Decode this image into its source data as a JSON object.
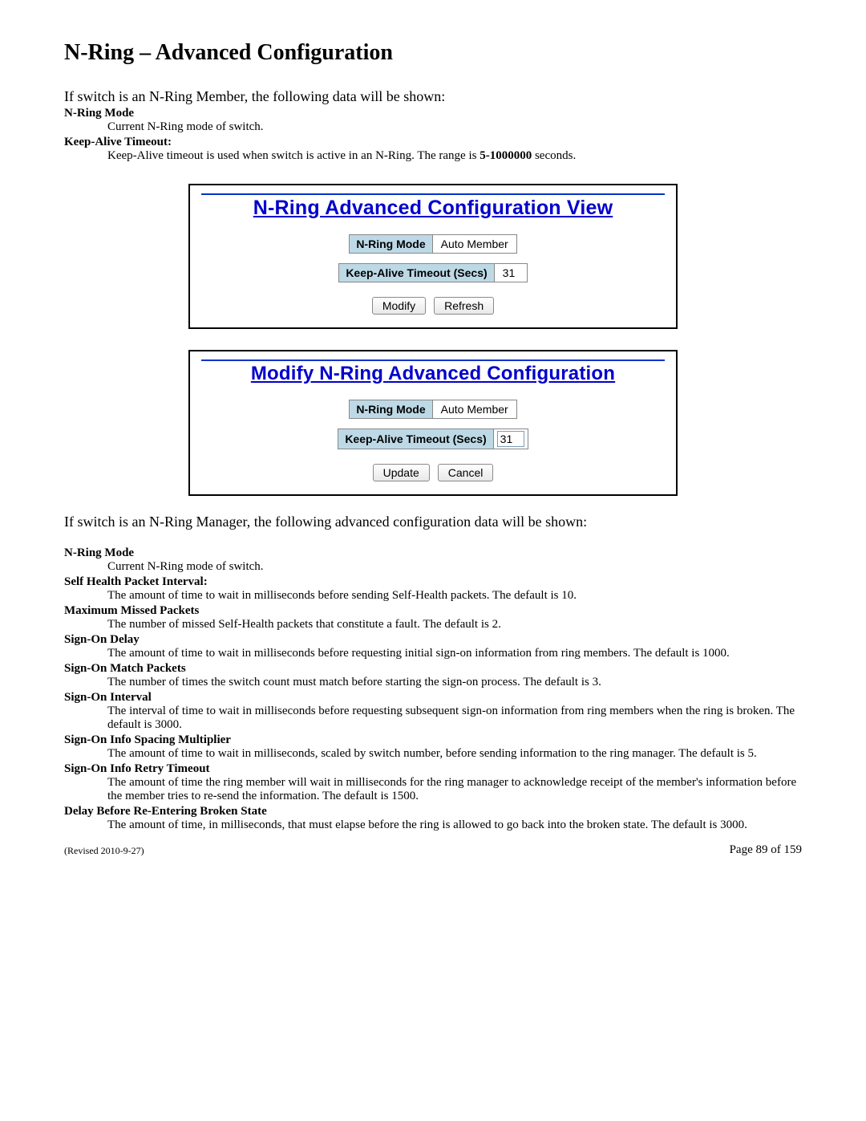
{
  "title": "N-Ring – Advanced Configuration",
  "member_intro": "If switch is an N-Ring Member, the following data will be shown:",
  "member_defs": {
    "mode_term": "N-Ring Mode",
    "mode_desc": "Current N-Ring mode of switch.",
    "keepalive_term": "Keep-Alive Timeout:",
    "keepalive_desc_pre": "Keep-Alive timeout is used when switch is active in an N-Ring. The range is ",
    "keepalive_range": "5-1000000",
    "keepalive_desc_post": " seconds."
  },
  "panel_view": {
    "title": "N-Ring Advanced Configuration View",
    "mode_label": "N-Ring Mode",
    "mode_value": "Auto Member",
    "keepalive_label": "Keep-Alive Timeout (Secs)",
    "keepalive_value": "31",
    "btn_modify": "Modify",
    "btn_refresh": "Refresh"
  },
  "panel_modify": {
    "title": "Modify N-Ring Advanced Configuration",
    "mode_label": "N-Ring Mode",
    "mode_value": "Auto Member",
    "keepalive_label": "Keep-Alive Timeout (Secs)",
    "keepalive_value": "31",
    "btn_update": "Update",
    "btn_cancel": "Cancel"
  },
  "manager_intro": "If switch is an N-Ring Manager, the following advanced configuration data will be shown:",
  "manager_defs": {
    "mode_term": "N-Ring Mode",
    "mode_desc": "Current N-Ring mode of switch.",
    "selfhealth_term": "Self Health Packet Interval:",
    "selfhealth_desc": "The amount of time to wait in milliseconds before sending Self-Health packets. The default is 10.",
    "maxmissed_term": "Maximum Missed Packets",
    "maxmissed_desc": "The number of missed Self-Health packets that constitute a fault. The default is 2.",
    "signon_delay_term": "Sign-On Delay",
    "signon_delay_desc": "The amount of time to wait in milliseconds before requesting initial sign-on information from ring members. The default is 1000.",
    "signon_match_term": "Sign-On Match Packets",
    "signon_match_desc": "The number of times the switch count must match before starting the sign-on process. The default is 3.",
    "signon_interval_term": "Sign-On Interval",
    "signon_interval_desc": "The interval of time to wait in milliseconds before requesting subsequent sign-on information from ring members when the ring is broken. The default is 3000.",
    "signon_spacing_term": "Sign-On Info Spacing Multiplier",
    "signon_spacing_desc": "The amount of time to wait in milliseconds, scaled by switch number, before sending information to the ring manager. The default is 5.",
    "signon_retry_term": "Sign-On Info Retry Timeout",
    "signon_retry_desc": "The amount of time the ring member will wait in milliseconds for the ring manager to acknowledge receipt of the member's information before the member tries to re-send the information. The default is 1500.",
    "delay_broken_term": "Delay Before Re-Entering Broken State",
    "delay_broken_desc": "The amount of time, in milliseconds, that must elapse before the ring is allowed to go back into the broken state. The default is 3000."
  },
  "footer": {
    "revised": "(Revised 2010-9-27)",
    "page": "Page 89 of 159"
  }
}
